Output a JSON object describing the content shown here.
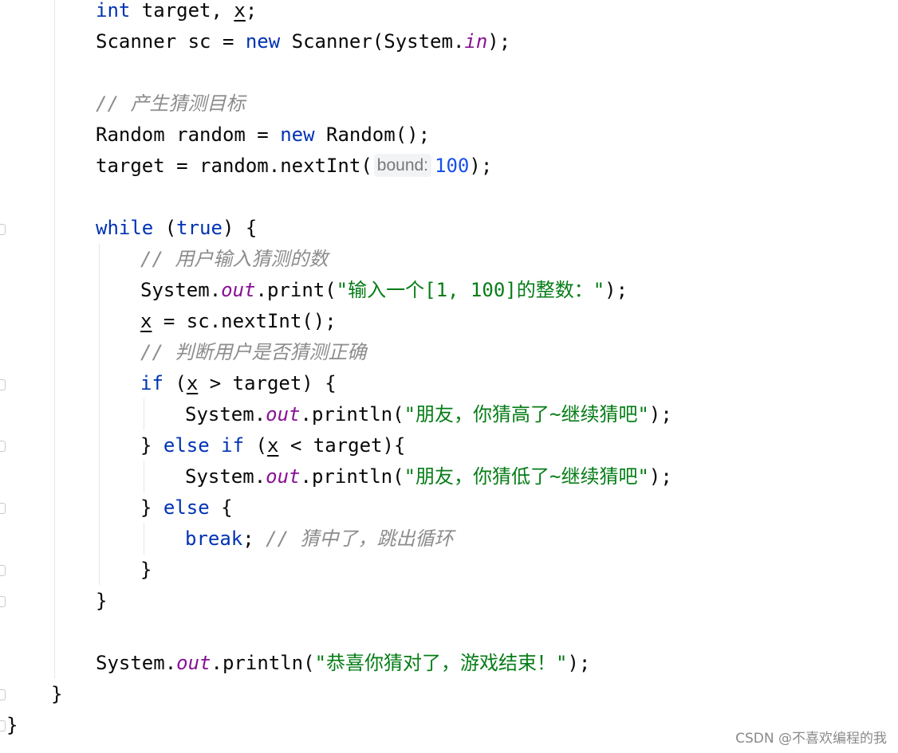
{
  "editor": {
    "lines": [
      [
        {
          "t": "int",
          "c": "kw"
        },
        {
          "t": " target, "
        },
        {
          "t": "x",
          "c": "var"
        },
        {
          "t": ";"
        }
      ],
      [
        {
          "t": "Scanner sc = "
        },
        {
          "t": "new",
          "c": "kw"
        },
        {
          "t": " Scanner(System."
        },
        {
          "t": "in",
          "c": "static"
        },
        {
          "t": ");"
        }
      ],
      [],
      [
        {
          "t": "// 产生猜测目标",
          "c": "cmt"
        }
      ],
      [
        {
          "t": "Random random = "
        },
        {
          "t": "new",
          "c": "kw"
        },
        {
          "t": " Random();"
        }
      ],
      [
        {
          "t": "target = random.nextInt("
        },
        {
          "t": "bound:",
          "c": "hint"
        },
        {
          "t": "100",
          "c": "num"
        },
        {
          "t": ");"
        }
      ],
      [],
      [
        {
          "t": "while",
          "c": "kw"
        },
        {
          "t": " ("
        },
        {
          "t": "true",
          "c": "kw"
        },
        {
          "t": ") {"
        }
      ],
      [
        {
          "t": "// 用户输入猜测的数",
          "c": "cmt"
        }
      ],
      [
        {
          "t": "System."
        },
        {
          "t": "out",
          "c": "static"
        },
        {
          "t": ".print("
        },
        {
          "t": "\"输入一个[1, 100]的整数：\"",
          "c": "str"
        },
        {
          "t": ");"
        }
      ],
      [
        {
          "t": "x",
          "c": "var"
        },
        {
          "t": " = sc.nextInt();"
        }
      ],
      [
        {
          "t": "// 判断用户是否猜测正确",
          "c": "cmt"
        }
      ],
      [
        {
          "t": "if",
          "c": "kw"
        },
        {
          "t": " ("
        },
        {
          "t": "x",
          "c": "var"
        },
        {
          "t": " > target) {"
        }
      ],
      [
        {
          "t": "System."
        },
        {
          "t": "out",
          "c": "static"
        },
        {
          "t": ".println("
        },
        {
          "t": "\"朋友，你猜高了~继续猜吧\"",
          "c": "str"
        },
        {
          "t": ");"
        }
      ],
      [
        {
          "t": "} "
        },
        {
          "t": "else if",
          "c": "kw"
        },
        {
          "t": " ("
        },
        {
          "t": "x",
          "c": "var"
        },
        {
          "t": " < target){"
        }
      ],
      [
        {
          "t": "System."
        },
        {
          "t": "out",
          "c": "static"
        },
        {
          "t": ".println("
        },
        {
          "t": "\"朋友，你猜低了~继续猜吧\"",
          "c": "str"
        },
        {
          "t": ");"
        }
      ],
      [
        {
          "t": "} "
        },
        {
          "t": "else",
          "c": "kw"
        },
        {
          "t": " {"
        }
      ],
      [
        {
          "t": "break",
          "c": "kw"
        },
        {
          "t": "; "
        },
        {
          "t": "// 猜中了，跳出循环",
          "c": "cmt"
        }
      ],
      [
        {
          "t": "}"
        }
      ],
      [
        {
          "t": "}"
        }
      ],
      [],
      [
        {
          "t": "System."
        },
        {
          "t": "out",
          "c": "static"
        },
        {
          "t": ".println("
        },
        {
          "t": "\"恭喜你猜对了，游戏结束！\"",
          "c": "str"
        },
        {
          "t": ");"
        }
      ],
      [
        {
          "t": "}"
        }
      ],
      [
        {
          "t": "}"
        }
      ]
    ]
  },
  "watermark": "CSDN @不喜欢编程的我",
  "colors": {
    "keyword": "#0033b3",
    "string": "#067d17",
    "number": "#1750eb",
    "comment": "#8c8c8c",
    "static_field": "#871094",
    "default_text": "#080808"
  }
}
